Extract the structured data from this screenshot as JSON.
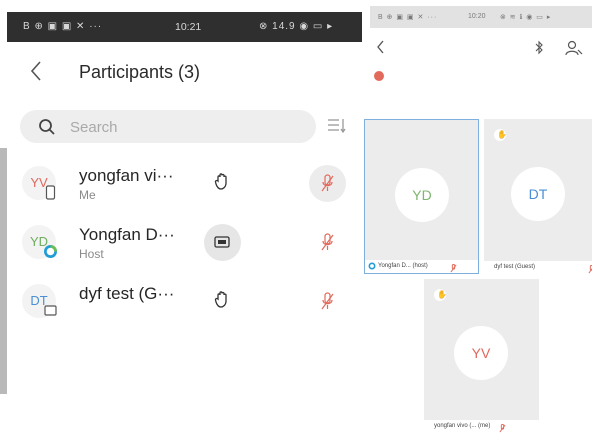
{
  "left": {
    "status": {
      "left_icons": "B ⊕ ▣ ▣ ✕ ···",
      "time": "10:21",
      "right_icons": "⊗ 14.9 ◉ ▭ ▸"
    },
    "title": "Participants (3)",
    "search": {
      "placeholder": "Search",
      "value": ""
    },
    "participants": [
      {
        "initials": "YV",
        "initials_color": "#e0685c",
        "badge": "phone-icon",
        "name": "yongfan vi···",
        "role": "Me",
        "raised_hand": true,
        "sharing": false,
        "mic": "muted",
        "mic_bg": true
      },
      {
        "initials": "YD",
        "initials_color": "#6fae5e",
        "badge": "webex-icon",
        "name": "Yongfan D···",
        "role": "Host",
        "raised_hand": false,
        "sharing": true,
        "mic": "muted",
        "mic_bg": false
      },
      {
        "initials": "DT",
        "initials_color": "#4b8fd6",
        "badge": "screen-icon",
        "name": "dyf test (G···",
        "role": "",
        "raised_hand": true,
        "sharing": false,
        "mic": "muted",
        "mic_bg": false
      }
    ]
  },
  "right": {
    "status": {
      "left_icons": "B ⊕ ▣ ▣ ✕ ···",
      "time": "10:20",
      "right_icons": "⊗ ≋ ℹ ◉ ▭ ▸"
    },
    "tiles": [
      {
        "initials": "YD",
        "initials_color": "#7fb56f",
        "caption": "Yongfan D... (host)",
        "active": true,
        "raised_hand": false,
        "webex_badge": true
      },
      {
        "initials": "DT",
        "initials_color": "#4b8fd6",
        "caption": "dyf test (Guest)",
        "active": false,
        "raised_hand": true,
        "webex_badge": false
      },
      {
        "initials": "YV",
        "initials_color": "#e0685c",
        "caption": "yongfan vivo (... (me)",
        "active": false,
        "raised_hand": true,
        "webex_badge": false
      }
    ]
  },
  "colors": {
    "mic_muted": "#e26a5c",
    "active_tile_border": "#7db0df"
  }
}
